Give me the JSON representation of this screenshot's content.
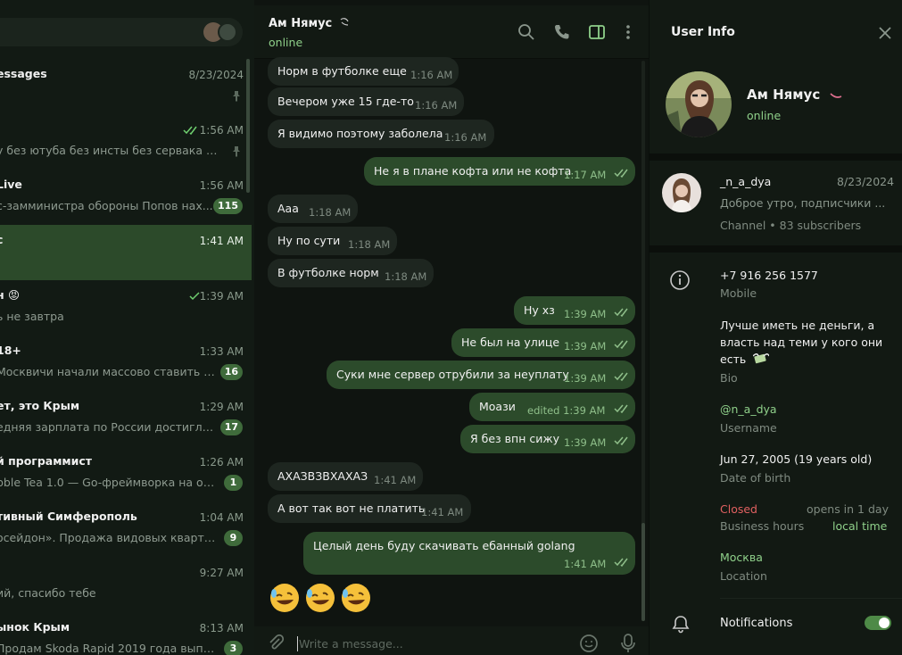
{
  "left": {
    "chats": [
      {
        "name": "essages",
        "time": "8/23/2024",
        "preview": "",
        "badge": "",
        "pinned": true,
        "read": false
      },
      {
        "name": "",
        "time": "1:56 AM",
        "preview": "у без ютуба без инсты без сервака без...",
        "badge": "",
        "pinned": true,
        "read": true
      },
      {
        "name": "Live",
        "time": "1:56 AM",
        "preview": "с-замминистра обороны Попов нах...",
        "badge": "115",
        "pinned": false,
        "read": false
      },
      {
        "name": "с",
        "time": "1:41 AM",
        "preview": "",
        "badge": "",
        "pinned": false,
        "read": false
      },
      {
        "name": "н 😡",
        "time": "1:39 AM",
        "preview": "ь не завтра",
        "badge": "",
        "pinned": false,
        "read": true
      },
      {
        "name": "18+",
        "time": "1:33 AM",
        "preview": "Москвичи начали массово ставить б...",
        "badge": "16",
        "pinned": false,
        "read": false
      },
      {
        "name": "ет, это Крым",
        "time": "1:29 AM",
        "preview": "едняя зарплата по России достигла п...",
        "badge": "17",
        "pinned": false,
        "read": false
      },
      {
        "name": "й программист",
        "time": "1:26 AM",
        "preview": "bble Tea 1.0 — Go-фреймворка на осно...",
        "badge": "1",
        "pinned": false,
        "read": false
      },
      {
        "name": "тивный Симферополь",
        "time": "1:04 AM",
        "preview": "осейдон». Продажа видовых квартир ...",
        "badge": "9",
        "pinned": false,
        "read": false
      },
      {
        "name": "",
        "time": "9:27 AM",
        "preview": "ий, спасибо тебе",
        "badge": "",
        "pinned": false,
        "read": false
      },
      {
        "name": "ынок Крым",
        "time": "8:13 AM",
        "preview": "Продам Skoda Rapid 2019 года выпуск...",
        "badge": "3",
        "pinned": false,
        "read": false
      }
    ]
  },
  "chat": {
    "name": "Ам Нямус",
    "status": "online",
    "messages": [
      {
        "dir": "in",
        "text": "Норм в футболке еще",
        "time": "1:16 AM"
      },
      {
        "dir": "in",
        "text": "Вечером уже 15 где-то",
        "time": "1:16 AM"
      },
      {
        "dir": "in",
        "text": "Я видимо поэтому заболела",
        "time": "1:16 AM"
      },
      {
        "dir": "out",
        "text": "Не я в плане кофта или не кофта",
        "time": "1:17 AM"
      },
      {
        "dir": "in",
        "text": "Ааа",
        "time": "1:18 AM"
      },
      {
        "dir": "in",
        "text": "Ну по сути",
        "time": "1:18 AM"
      },
      {
        "dir": "in",
        "text": "В футболке норм",
        "time": "1:18 AM"
      },
      {
        "dir": "out",
        "text": "Ну хз",
        "time": "1:39 AM"
      },
      {
        "dir": "out",
        "text": "Не был на улице",
        "time": "1:39 AM"
      },
      {
        "dir": "out",
        "text": "Суки мне сервер отрубили за неуплату",
        "time": "1:39 AM"
      },
      {
        "dir": "out",
        "text": "Моази",
        "time": "edited 1:39 AM"
      },
      {
        "dir": "out",
        "text": "Я без впн сижу",
        "time": "1:39 AM"
      },
      {
        "dir": "in",
        "text": "АХАЗВЗВХАХАЗ",
        "time": "1:41 AM"
      },
      {
        "dir": "in",
        "text": "А вот так вот не платить",
        "time": "1:41 AM"
      },
      {
        "dir": "out",
        "text": "Целый день буду скачивать ебанный golang",
        "time": "1:41 AM"
      }
    ],
    "emoji_row": [
      "rofl-emoji",
      "rofl-emoji",
      "rofl-emoji"
    ],
    "composer_placeholder": "Write a message..."
  },
  "info": {
    "title": "User Info",
    "name": "Ам Нямус",
    "status": "online",
    "channel": {
      "name": "_n_a_dya",
      "date": "8/23/2024",
      "preview": "Доброе утро, подписчики ...",
      "meta": "Channel • 83 subscribers"
    },
    "phone": "+7 916 256 1577",
    "phone_label": "Mobile",
    "bio_line1": "Лучше иметь не деньги, а",
    "bio_line2": "власть над теми у кого они",
    "bio_line3": "есть",
    "bio_label": "Bio",
    "username": "@n_a_dya",
    "username_label": "Username",
    "birth": "Jun 27, 2005 (19 years old)",
    "birth_label": "Date of birth",
    "hours_status": "Closed",
    "hours_opens": "opens in 1 day",
    "hours_label": "Business hours",
    "hours_local": "local time",
    "location": "Москва",
    "location_label": "Location",
    "notifications": "Notifications",
    "notifications_on": true
  },
  "colors": {
    "accent": "#8fd08a",
    "bubble_out": "#2c4b2b",
    "bubble_in": "#1e2620",
    "badge": "#3f6b3b",
    "closed": "#e06060"
  }
}
